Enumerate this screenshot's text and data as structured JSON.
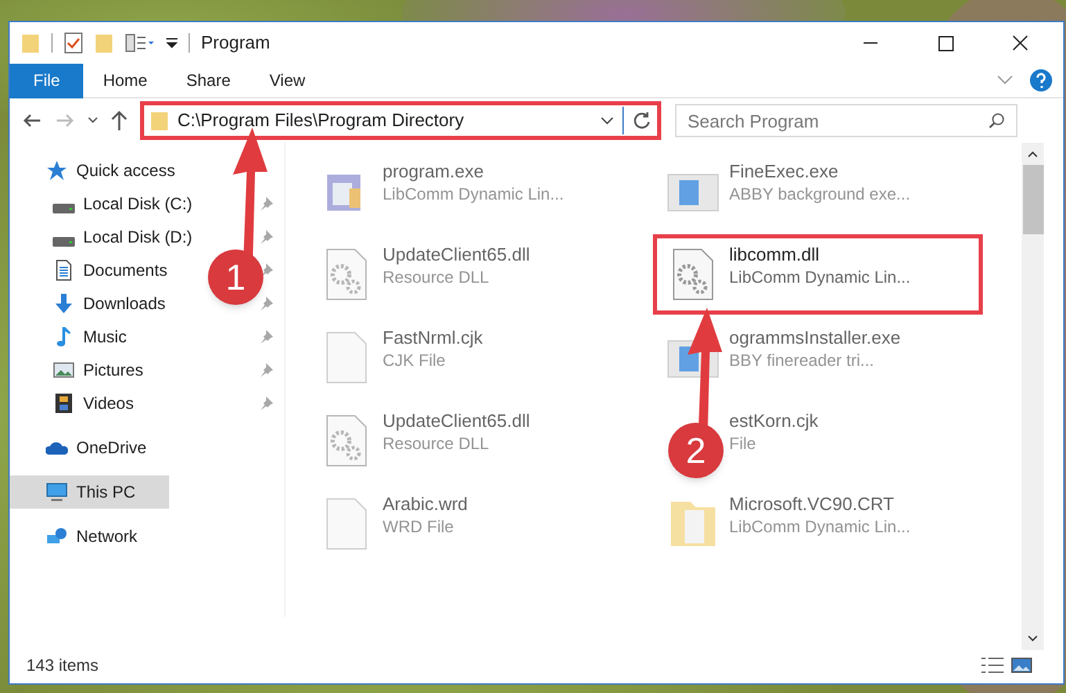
{
  "window": {
    "title": "Program"
  },
  "ribbon_tabs": [
    {
      "label": "File",
      "selected": true
    },
    {
      "label": "Home",
      "selected": false
    },
    {
      "label": "Share",
      "selected": false
    },
    {
      "label": "View",
      "selected": false
    }
  ],
  "address_bar": {
    "path": "C:\\Program Files\\Program Directory",
    "highlighted": true
  },
  "search": {
    "placeholder": "Search Program"
  },
  "navigation": [
    {
      "label": "Quick access",
      "kind": "star",
      "selected": false,
      "children": [
        {
          "label": "Local Disk (C:)",
          "kind": "drive",
          "pinned": true,
          "selected": false
        },
        {
          "label": "Local Disk (D:)",
          "kind": "drive",
          "pinned": true,
          "selected": false
        },
        {
          "label": "Documents",
          "kind": "document",
          "pinned": true,
          "selected": false
        },
        {
          "label": "Downloads",
          "kind": "download",
          "pinned": true,
          "selected": false
        },
        {
          "label": "Music",
          "kind": "music",
          "pinned": true,
          "selected": false
        },
        {
          "label": "Pictures",
          "kind": "pictures",
          "pinned": true,
          "selected": false
        },
        {
          "label": "Videos",
          "kind": "videos",
          "pinned": true,
          "selected": false
        }
      ]
    },
    {
      "label": "OneDrive",
      "kind": "cloud",
      "selected": false
    },
    {
      "label": "This PC",
      "kind": "computer",
      "selected": true
    },
    {
      "label": "Network",
      "kind": "network",
      "selected": false
    }
  ],
  "files": [
    {
      "name": "program.exe",
      "type": "LibComm Dynamic Lin...",
      "kind": "program",
      "blurred": true,
      "highlighted": false
    },
    {
      "name": "FineExec.exe",
      "type": "ABBY background exe...",
      "kind": "window",
      "blurred": true,
      "highlighted": false
    },
    {
      "name": "UpdateClient65.dll",
      "type": "Resource DLL",
      "kind": "gear",
      "blurred": true,
      "highlighted": false
    },
    {
      "name": "libcomm.dll",
      "type": "LibComm Dynamic Lin...",
      "kind": "gear",
      "blurred": false,
      "highlighted": true
    },
    {
      "name": "FastNrml.cjk",
      "type": "CJK File",
      "kind": "blank",
      "blurred": true,
      "highlighted": false
    },
    {
      "name": "ogrammsInstaller.exe",
      "type": "BBY finereader tri...",
      "kind": "window",
      "blurred": true,
      "highlighted": false
    },
    {
      "name": "UpdateClient65.dll",
      "type": "Resource DLL",
      "kind": "gear",
      "blurred": true,
      "highlighted": false
    },
    {
      "name": "estKorn.cjk",
      "type": "File",
      "kind": "covered",
      "blurred": true,
      "highlighted": false
    },
    {
      "name": "Arabic.wrd",
      "type": "WRD File",
      "kind": "blank",
      "blurred": true,
      "highlighted": false
    },
    {
      "name": "Microsoft.VC90.CRT",
      "type": "LibComm Dynamic Lin...",
      "kind": "folder",
      "blurred": true,
      "highlighted": false
    }
  ],
  "status_bar": {
    "item_count": "143 items"
  },
  "annotations": [
    {
      "number": "1"
    },
    {
      "number": "2"
    }
  ]
}
